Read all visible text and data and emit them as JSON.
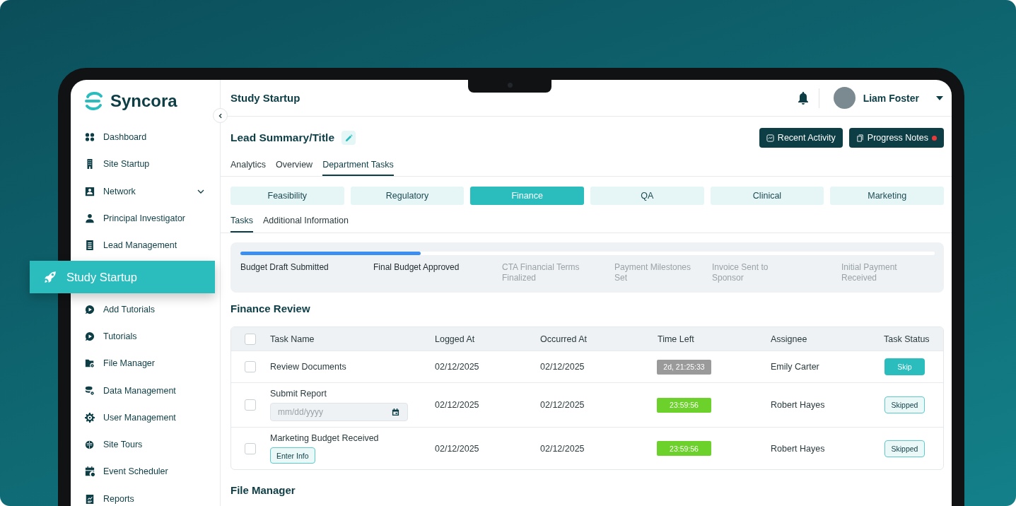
{
  "brand": "Syncora",
  "sidebar": {
    "items": [
      {
        "label": "Dashboard",
        "selected": false,
        "kind": "link"
      },
      {
        "label": "Site Startup",
        "selected": false,
        "kind": "link"
      },
      {
        "label": "Network",
        "selected": false,
        "kind": "group"
      },
      {
        "label": "Principal Investigator",
        "selected": false,
        "kind": "link"
      },
      {
        "label": "Lead Management",
        "selected": false,
        "kind": "link"
      },
      {
        "label": "Study Startup",
        "selected": true,
        "kind": "link"
      },
      {
        "label": "Add Tutorials",
        "selected": false,
        "kind": "link"
      },
      {
        "label": "Tutorials",
        "selected": false,
        "kind": "link"
      },
      {
        "label": "File Manager",
        "selected": false,
        "kind": "link"
      },
      {
        "label": "Data Management",
        "selected": false,
        "kind": "link"
      },
      {
        "label": "User Management",
        "selected": false,
        "kind": "link"
      },
      {
        "label": "Site Tours",
        "selected": false,
        "kind": "link"
      },
      {
        "label": "Event Scheduler",
        "selected": false,
        "kind": "link"
      },
      {
        "label": "Reports",
        "selected": false,
        "kind": "link"
      }
    ]
  },
  "header": {
    "title": "Study Startup",
    "user": "Liam Foster"
  },
  "lead": {
    "title": "Lead Summary/Title",
    "buttons": [
      {
        "label": "Recent Activity",
        "notification": false
      },
      {
        "label": "Progress Notes",
        "notification": true
      }
    ]
  },
  "tabs": [
    {
      "label": "Analytics",
      "selected": false
    },
    {
      "label": "Overview",
      "selected": false
    },
    {
      "label": "Department Tasks",
      "selected": true
    }
  ],
  "departments": [
    {
      "label": "Feasibility",
      "selected": false
    },
    {
      "label": "Regulatory",
      "selected": false
    },
    {
      "label": "Finance",
      "selected": true
    },
    {
      "label": "QA",
      "selected": false
    },
    {
      "label": "Clinical",
      "selected": false
    },
    {
      "label": "Marketing",
      "selected": false
    }
  ],
  "subtabs": [
    {
      "label": "Tasks",
      "selected": true
    },
    {
      "label": "Additional Information",
      "selected": false
    }
  ],
  "progress": {
    "level": 0.26,
    "steps": [
      {
        "label": "Budget Draft Submitted",
        "done": true
      },
      {
        "label": "Final Budget Approved",
        "done": true
      },
      {
        "label": "CTA Financial Terms Finalized",
        "done": false
      },
      {
        "label": "Payment Milestones Set",
        "done": false
      },
      {
        "label": "Invoice Sent to Sponsor",
        "done": false
      },
      {
        "label": "Initial Payment Received",
        "done": false
      }
    ]
  },
  "finance_review": {
    "title": "Finance Review",
    "select_all_checked": false,
    "columns": [
      "Task Name",
      "Logged At",
      "Occurred At",
      "Time Left",
      "Assignee",
      "Task Status"
    ],
    "rows": [
      {
        "checked": false,
        "task": "Review Documents",
        "logged_at": "02/12/2025",
        "occurred_at": "02/12/2025",
        "time_left": {
          "text": "2d, 21:25:33",
          "color": "#9a9a9a"
        },
        "assignee": "Emily Carter",
        "status": {
          "label": "Skip",
          "kind": "solid"
        }
      },
      {
        "checked": false,
        "task": "Submit Report",
        "extra": {
          "kind": "date",
          "placeholder": "mm/dd/yyyy"
        },
        "logged_at": "02/12/2025",
        "occurred_at": "02/12/2025",
        "time_left": {
          "text": "23:59:56",
          "color": "#6dd12b"
        },
        "assignee": "Robert Hayes",
        "status": {
          "label": "Skipped",
          "kind": "outline"
        }
      },
      {
        "checked": false,
        "task": "Marketing Budget Received",
        "extra": {
          "kind": "button",
          "label": "Enter Info"
        },
        "logged_at": "02/12/2025",
        "occurred_at": "02/12/2025",
        "time_left": {
          "text": "23:59:56",
          "color": "#6dd12b"
        },
        "assignee": "Robert Hayes",
        "status": {
          "label": "Skipped",
          "kind": "outline"
        }
      }
    ]
  },
  "file_manager": {
    "title": "File Manager"
  }
}
